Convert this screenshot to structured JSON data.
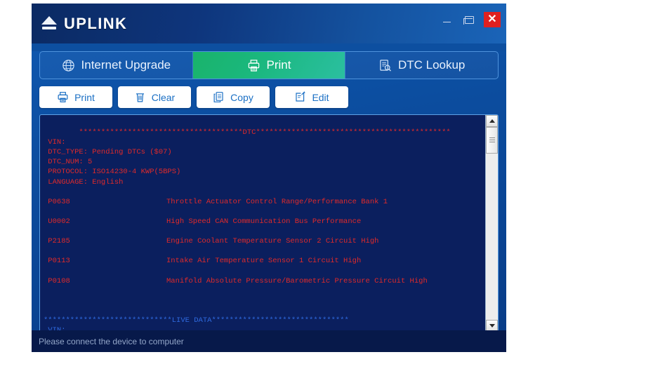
{
  "window": {
    "brand": "UPLINK",
    "logo_icon": "eject-icon",
    "controls": {
      "minimize": "minimize-icon",
      "maximize": "maximize-icon",
      "close_label": "✕",
      "close_color": "#e02020"
    }
  },
  "tabs": [
    {
      "label": "Internet Upgrade",
      "icon": "globe-icon",
      "active": false
    },
    {
      "label": "Print",
      "icon": "printer-icon",
      "active": true
    },
    {
      "label": "DTC Lookup",
      "icon": "document-search-icon",
      "active": false
    }
  ],
  "toolbar": [
    {
      "label": "Print",
      "icon": "printer-icon"
    },
    {
      "label": "Clear",
      "icon": "trash-icon"
    },
    {
      "label": "Copy",
      "icon": "copy-icon"
    },
    {
      "label": "Edit",
      "icon": "edit-pencil-icon"
    }
  ],
  "output": {
    "dtc_header": "*************************************DTC********************************************",
    "fields": [
      " VIN:",
      " DTC_TYPE: Pending DTCs ($07)",
      " DTC_NUM: 5",
      " PROTOCOL: ISO14230-4 KWP(5BPS)",
      " LANGUAGE: English"
    ],
    "codes": [
      {
        "code": " P0638",
        "desc": "Throttle Actuator Control Range/Performance Bank 1"
      },
      {
        "code": " U0002",
        "desc": "High Speed CAN Communication Bus Performance"
      },
      {
        "code": " P2185",
        "desc": "Engine Coolant Temperature Sensor 2 Circuit High"
      },
      {
        "code": " P0113",
        "desc": "Intake Air Temperature Sensor 1 Circuit High"
      },
      {
        "code": " P0108",
        "desc": "Manifold Absolute Pressure/Barometric Pressure Circuit High"
      }
    ],
    "livedata_header": "*****************************LIVE DATA*******************************",
    "livedata_fields": [
      " VIN:"
    ],
    "text_color_red": "#e02a2a",
    "text_color_blue": "#2f6ae0"
  },
  "scrollbar": {
    "up_icon": "chevron-up-icon",
    "down_icon": "chevron-down-icon"
  },
  "status": {
    "message": "Please connect the device to computer"
  }
}
